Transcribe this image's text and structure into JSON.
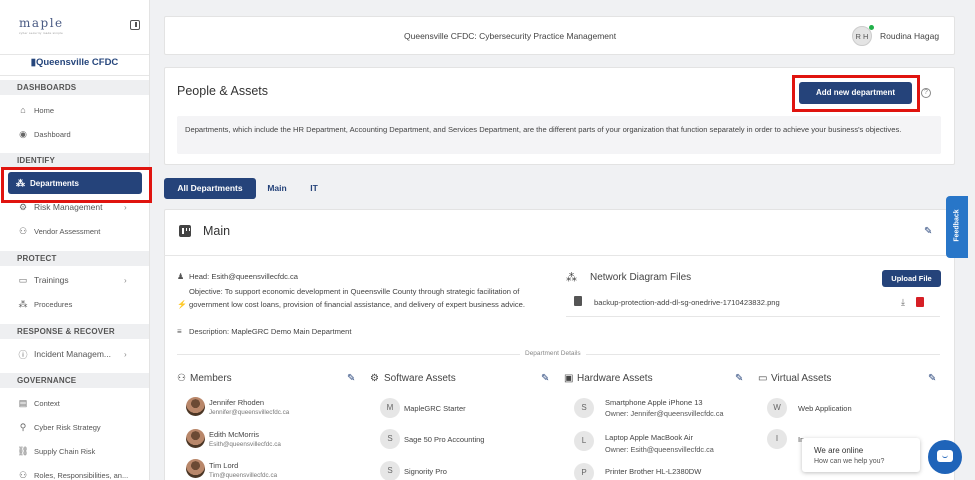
{
  "brand": {
    "logo_text": "maple",
    "logo_sub": "cyber security made simple"
  },
  "sidebar": {
    "org_name": "Queensville CFDC",
    "sections": {
      "dashboards": "DASHBOARDS",
      "identify": "IDENTIFY",
      "protect": "PROTECT",
      "respond": "RESPONSE & RECOVER",
      "governance": "GOVERNANCE"
    },
    "items": {
      "home": "Home",
      "dashboard": "Dashboard",
      "departments": "Departments",
      "risk": "Risk Management",
      "vendor": "Vendor Assessment",
      "trainings": "Trainings",
      "procedures": "Procedures",
      "incident": "Incident Managem...",
      "context": "Context",
      "cyber": "Cyber Risk Strategy",
      "supply": "Supply Chain Risk",
      "roles": "Roles, Responsibilities, an..."
    }
  },
  "topbar": {
    "title": "Queensville CFDC: Cybersecurity Practice Management",
    "initials": "R H",
    "username": "Roudina Hagag"
  },
  "page": {
    "title": "People & Assets",
    "add_button": "Add new department",
    "description": "Departments, which include the HR Department, Accounting Department, and Services Department, are the different parts of your organization that function separately in order to achieve your business's objectives."
  },
  "tabs": [
    "All Departments",
    "Main",
    "IT"
  ],
  "department": {
    "name": "Main",
    "head": "Head: Esith@queensvillecfdc.ca",
    "objective": "Objective: To support economic development in Queensville County through strategic facilitation of government low cost loans, provision of financial assistance, and delivery of expert business advice.",
    "description": "Description: MapleGRC Demo Main Department",
    "network_title": "Network Diagram Files",
    "upload_button": "Upload File",
    "file_name": "backup-protection-add-dl-sg-onedrive-1710423832.png",
    "details_label": "Department Details"
  },
  "columns": {
    "members": "Members",
    "software": "Software Assets",
    "hardware": "Hardware Assets",
    "virtual": "Virtual Assets"
  },
  "members": [
    {
      "name": "Jennifer Rhoden",
      "email": "Jennifer@queensvillecfdc.ca"
    },
    {
      "name": "Edith McMorris",
      "email": "Esith@queensvillecfdc.ca"
    },
    {
      "name": "Tim Lord",
      "email": "Tim@queensvillecfdc.ca"
    }
  ],
  "software": [
    {
      "initial": "M",
      "name": "MapleGRC Starter"
    },
    {
      "initial": "S",
      "name": "Sage 50 Pro Accounting"
    },
    {
      "initial": "S",
      "name": "Signority Pro"
    }
  ],
  "hardware": [
    {
      "initial": "S",
      "name": "Smartphone Apple iPhone 13",
      "owner": "Owner: Jennifer@queensvillecfdc.ca"
    },
    {
      "initial": "L",
      "name": "Laptop Apple MacBook Air",
      "owner": "Owner: Esith@queensvillecfdc.ca"
    },
    {
      "initial": "P",
      "name": "Printer Brother HL-L2380DW",
      "owner": ""
    }
  ],
  "virtual": [
    {
      "initial": "W",
      "name": "Web Application"
    },
    {
      "initial": "I",
      "name": "In"
    }
  ],
  "feedback": "Feedback",
  "chat": {
    "line1": "We are online",
    "line2": "How can we help you?"
  },
  "colors": {
    "primary": "#25437a",
    "highlight": "#e0140f",
    "feedback": "#2876c8"
  }
}
